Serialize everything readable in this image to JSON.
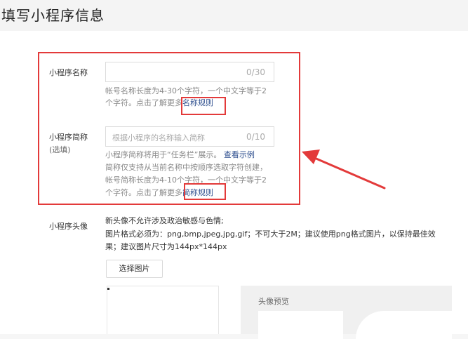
{
  "page": {
    "title": "填写小程序信息"
  },
  "name_section": {
    "label": "小程序名称",
    "input_value": "",
    "counter": "0/30",
    "help_line1": "帐号名称长度为4-30个字符，一个中文字等于2",
    "help_line2": "个字符。点击了解更多",
    "rule_link": "名称规则"
  },
  "short_name_section": {
    "label": "小程序简称",
    "optional": "(选填)",
    "placeholder": "根据小程序的名称输入简称",
    "counter": "0/10",
    "help_line1_text": "小程序简称将用于“任务栏”展示。",
    "example_link": "查看示例",
    "help_line2": "简称仅支持从当前名称中按顺序选取字符创建，",
    "help_line3": "帐号简称长度为4-10个字符，一个中文字等于2",
    "help_line4": "个字符。点击了解更多",
    "rule_link": "简称规则"
  },
  "avatar_section": {
    "label": "小程序头像",
    "note1": "新头像不允许涉及政治敏感与色情;",
    "note2": "图片格式必须为：png,bmp,jpeg,jpg,gif；不可大于2M；建议使用png格式图片，以保持最佳效",
    "note3": "果；建议图片尺寸为144px*144px",
    "select_button": "选择图片",
    "preview_title": "头像预览"
  },
  "colors": {
    "annotation_red": "#e33a3a",
    "link_blue": "#2d4e8e"
  }
}
